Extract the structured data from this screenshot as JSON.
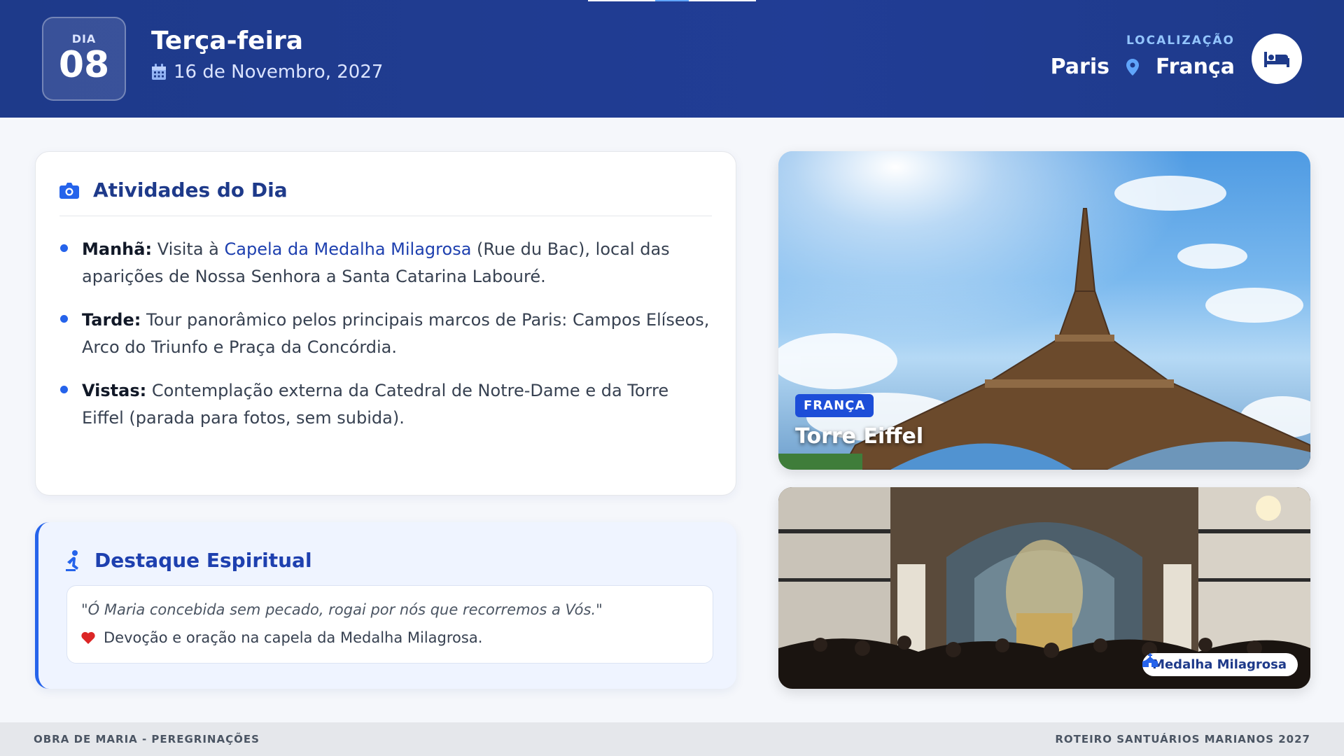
{
  "header": {
    "day_label": "DIA",
    "day_number": "08",
    "weekday": "Terça-feira",
    "date": "16 de Novembro, 2027",
    "location_label": "LOCALIZAÇÃO",
    "city": "Paris",
    "country": "França",
    "icons": [
      "calendar-icon",
      "map-pin-icon",
      "bed-icon"
    ],
    "colors": {
      "background": "#1e3a8a",
      "accent": "#60a5fa"
    }
  },
  "activities": {
    "title": "Atividades do Dia",
    "icon": "camera-icon",
    "items": [
      {
        "label": "Manhã:",
        "pre": "Visita à",
        "highlight": "Capela da Medalha Milagrosa",
        "post": "(Rue du Bac), local das aparições de Nossa Senhora a Santa Catarina Labouré."
      },
      {
        "label": "Tarde:",
        "text": "Tour panorâmico pelos principais marcos de Paris: Campos Elíseos, Arco do Triunfo e Praça da Concórdia."
      },
      {
        "label": "Vistas:",
        "text": "Contemplação externa da Catedral de Notre-Dame e da Torre Eiffel (parada para fotos, sem subida)."
      }
    ]
  },
  "spiritual": {
    "title": "Destaque Espiritual",
    "icon": "praying-person-icon",
    "quote": "\"Ó Maria concebida sem pecado, rogai por nós que recorremos a Vós.\"",
    "devotion": "Devoção e oração na capela da Medalha Milagrosa.",
    "devotion_icon": "heart-icon"
  },
  "photos": {
    "eiffel": {
      "badge": "FRANÇA",
      "caption": "Torre Eiffel"
    },
    "chapel": {
      "chip": "Medalha Milagrosa",
      "chip_icon": "church-icon"
    }
  },
  "footer": {
    "left": "OBRA DE MARIA - PEREGRINAÇÕES",
    "right": "ROTEIRO SANTUÁRIOS MARIANOS 2027"
  }
}
